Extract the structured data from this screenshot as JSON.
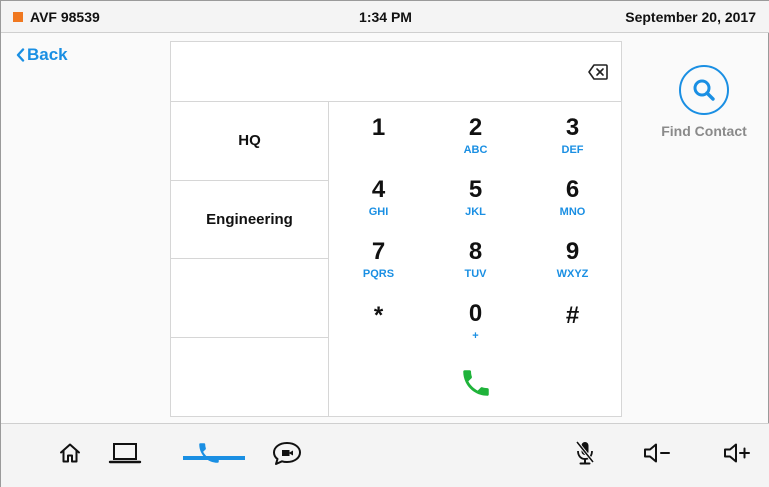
{
  "status": {
    "room_name": "AVF 98539",
    "time": "1:34 PM",
    "date": "September 20, 2017",
    "indicator_color": "#f07820"
  },
  "back": {
    "label": "Back"
  },
  "dialer": {
    "input_value": "",
    "quick_dial": [
      "HQ",
      "Engineering",
      "",
      ""
    ],
    "keys": [
      {
        "num": "1",
        "letters": ""
      },
      {
        "num": "2",
        "letters": "ABC"
      },
      {
        "num": "3",
        "letters": "DEF"
      },
      {
        "num": "4",
        "letters": "GHI"
      },
      {
        "num": "5",
        "letters": "JKL"
      },
      {
        "num": "6",
        "letters": "MNO"
      },
      {
        "num": "7",
        "letters": "PQRS"
      },
      {
        "num": "8",
        "letters": "TUV"
      },
      {
        "num": "9",
        "letters": "WXYZ"
      },
      {
        "num": "*",
        "letters": ""
      },
      {
        "num": "0",
        "letters": "+"
      },
      {
        "num": "#",
        "letters": ""
      }
    ]
  },
  "find_contact": {
    "label": "Find Contact"
  },
  "bottom_nav": {
    "items": [
      "home-icon",
      "laptop-icon",
      "phone-icon",
      "chat-video-icon",
      "mic-muted-icon",
      "volume-down-icon",
      "volume-up-icon"
    ],
    "active": "phone-icon"
  },
  "colors": {
    "accent": "#1a8fe3",
    "call_green": "#1fb33a",
    "status_indicator": "#f07820"
  }
}
